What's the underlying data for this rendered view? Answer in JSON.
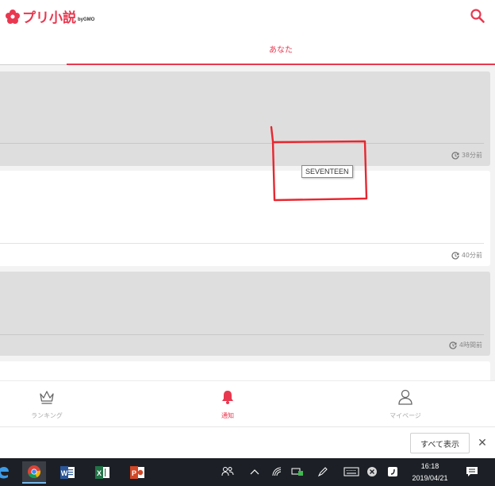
{
  "header": {
    "logo_text": "プリ小説",
    "logo_sub": "byGMO"
  },
  "tabs": {
    "active_label": "あなた"
  },
  "cards": [
    {
      "time": "38分前"
    },
    {
      "time": "40分前"
    },
    {
      "time": "4時間前"
    }
  ],
  "annotation": {
    "tooltip": "SEVENTEEN",
    "stroke_color": "#e8262f"
  },
  "bottom_nav": {
    "ranking_label": "ランキング",
    "notice_label": "通知",
    "mypage_label": "マイページ"
  },
  "banner": {
    "show_all_label": "すべて表示",
    "close_label": "✕"
  },
  "taskbar": {
    "time": "16:18",
    "date": "2019/04/21"
  },
  "colors": {
    "accent": "#e8384f",
    "taskbar": "#1c2026"
  },
  "icons": [
    "logo-flower-icon",
    "search-icon",
    "clock-icon",
    "crown-icon",
    "bell-icon",
    "user-icon",
    "edge-icon",
    "chrome-icon",
    "word-icon",
    "excel-icon",
    "powerpoint-icon"
  ]
}
